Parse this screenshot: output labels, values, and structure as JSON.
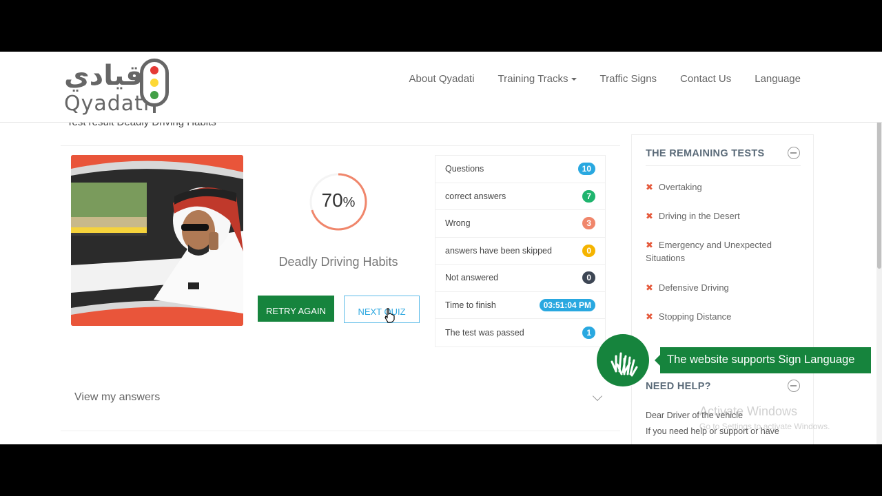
{
  "header": {
    "logo_arabic": "قيادي",
    "logo_english": "Qyadati",
    "nav": [
      {
        "label": "About Qyadati"
      },
      {
        "label": "Training Tracks"
      },
      {
        "label": "Traffic Signs"
      },
      {
        "label": "Contact Us"
      },
      {
        "label": "Language"
      }
    ]
  },
  "main": {
    "page_title": "Test result Deadly Driving Habits",
    "score_value": "70",
    "score_unit": "%",
    "score_fraction": 0.7,
    "quiz_name": "Deadly Driving Habits",
    "retry_label": "RETRY AGAIN",
    "next_label": "NEXT QUIZ",
    "view_answers_label": "View my answers"
  },
  "stats": [
    {
      "label": "Questions",
      "value": "10",
      "color": "#29a8e0"
    },
    {
      "label": "correct answers",
      "value": "7",
      "color": "#1fb46e"
    },
    {
      "label": "Wrong",
      "value": "3",
      "color": "#f0866b"
    },
    {
      "label": "answers have been skipped",
      "value": "0",
      "color": "#f5b400"
    },
    {
      "label": "Not answered",
      "value": "0",
      "color": "#3d4654"
    },
    {
      "label": "Time to finish",
      "value": "03:51:04 PM",
      "color": "#29a8e0"
    },
    {
      "label": "The test was passed",
      "value": "1",
      "color": "#29a8e0"
    }
  ],
  "sidebar": {
    "remaining_title": "THE REMAINING TESTS",
    "tests": [
      {
        "label": "Overtaking"
      },
      {
        "label": "Driving in the Desert"
      },
      {
        "label": "Emergency and Unexpected Situations"
      },
      {
        "label": "Defensive Driving"
      },
      {
        "label": "Stopping Distance"
      }
    ],
    "help_title": "NEED HELP?",
    "help_line1": "Dear Driver of the vehicle",
    "help_line2": "If you need help or support or have"
  },
  "sign_language": {
    "banner": "The website supports Sign Language"
  },
  "watermark": {
    "line1": "Activate Windows",
    "line2": "Go to Settings to activate Windows."
  },
  "colors": {
    "brand_green": "#16843d",
    "accent_blue": "#29a8e0",
    "ring_orange": "#f0866b"
  }
}
